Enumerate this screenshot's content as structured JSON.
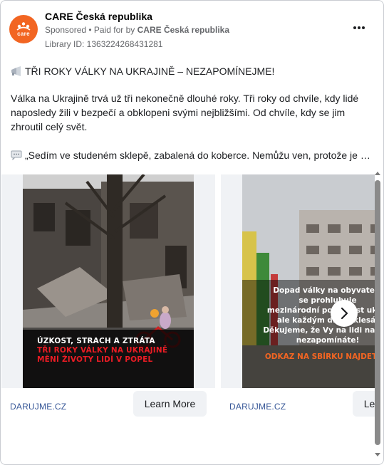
{
  "ad": {
    "page_name": "CARE Česká republika",
    "sponsored": "Sponsored",
    "paid_for_prefix": " • Paid for by ",
    "paid_for_by": "CARE Česká republika",
    "library_id": "Library ID: 1363224268431281",
    "logo_text": "care",
    "brand_color": "#f26522"
  },
  "post": {
    "headline": "TŘI ROKY VÁLKY NA UKRAJINĚ – NEZAPOMÍNEJME!",
    "paragraph": "Válka na Ukrajině trvá už tři nekonečně dlouhé roky. Tři roky od chvíle, kdy lidé naposledy žili v bezpečí a obklopeni svými nejbližšími. Od chvíle, kdy se jim zhroutil celý svět.",
    "quote": "„Sedím ve studeném sklepě, zabalená do koberce. Nemůžu ven, protože je to...",
    "headline_icon": "megaphone-icon",
    "quote_icon": "speech-bubble-icon"
  },
  "cards": [
    {
      "overlay_lines_white": [
        "ÚZKOST, STRACH A ZTRÁTA"
      ],
      "overlay_lines_red": [
        "TŘI ROKY VÁLKY NA UKRAJINĚ",
        "MĚNÍ ŽIVOTY LIDÍ V POPEL"
      ],
      "domain": "DARUJME.CZ",
      "button": "Learn More"
    },
    {
      "overlay_lines": [
        "Dopad války na obyvatele",
        "se prohlubuje",
        "mezinárodní pozornost ukraj",
        "ale každým dnem klesá.",
        "Děkujeme, že Vy na lidi na Ukr",
        "nezapomínáte!"
      ],
      "cta": "ODKAZ NA SBÍRKU NAJDETE V",
      "domain": "DARUJME.CZ",
      "button": "Learn More"
    }
  ],
  "colors": {
    "accent_red": "#ea1c24",
    "link_blue": "#385898",
    "cta_orange": "#f26522"
  }
}
